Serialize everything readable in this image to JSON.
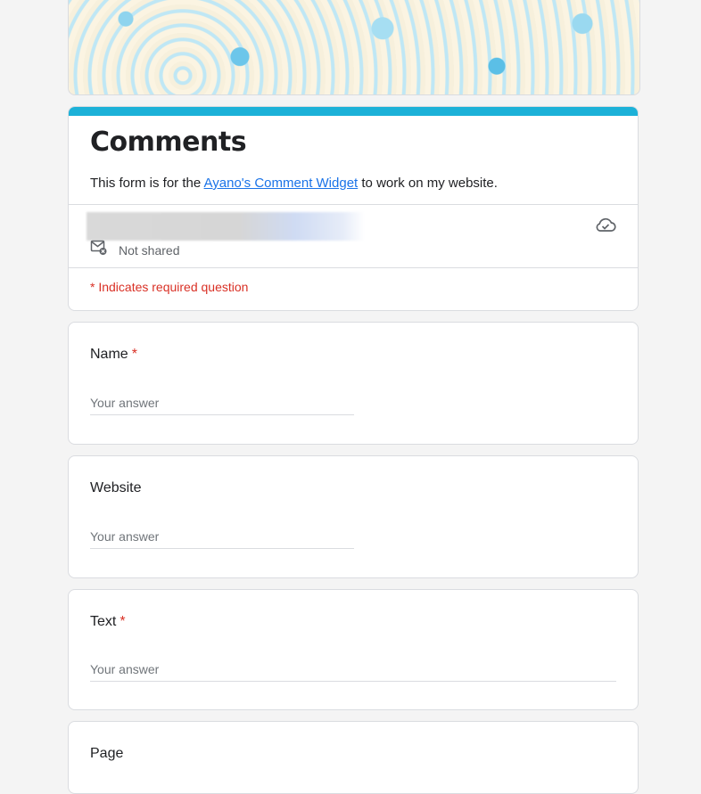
{
  "form": {
    "title": "Comments",
    "description_before": "This form is for the ",
    "description_link": "Ayano's Comment Widget",
    "description_after": " to work on my website.",
    "email_status": "Not shared",
    "required_note": "* Indicates required question"
  },
  "questions": [
    {
      "label": "Name",
      "required": "*",
      "placeholder": "Your answer"
    },
    {
      "label": "Website",
      "required": "",
      "placeholder": "Your answer"
    },
    {
      "label": "Text",
      "required": "*",
      "placeholder": "Your answer"
    },
    {
      "label": "Page",
      "required": "",
      "placeholder": ""
    }
  ],
  "colors": {
    "accent": "#1cb1d8",
    "required": "#d93025",
    "link": "#1a73e8"
  },
  "icons": {
    "email_not_shared": "mail-off-icon",
    "save_status": "cloud-done-icon"
  }
}
